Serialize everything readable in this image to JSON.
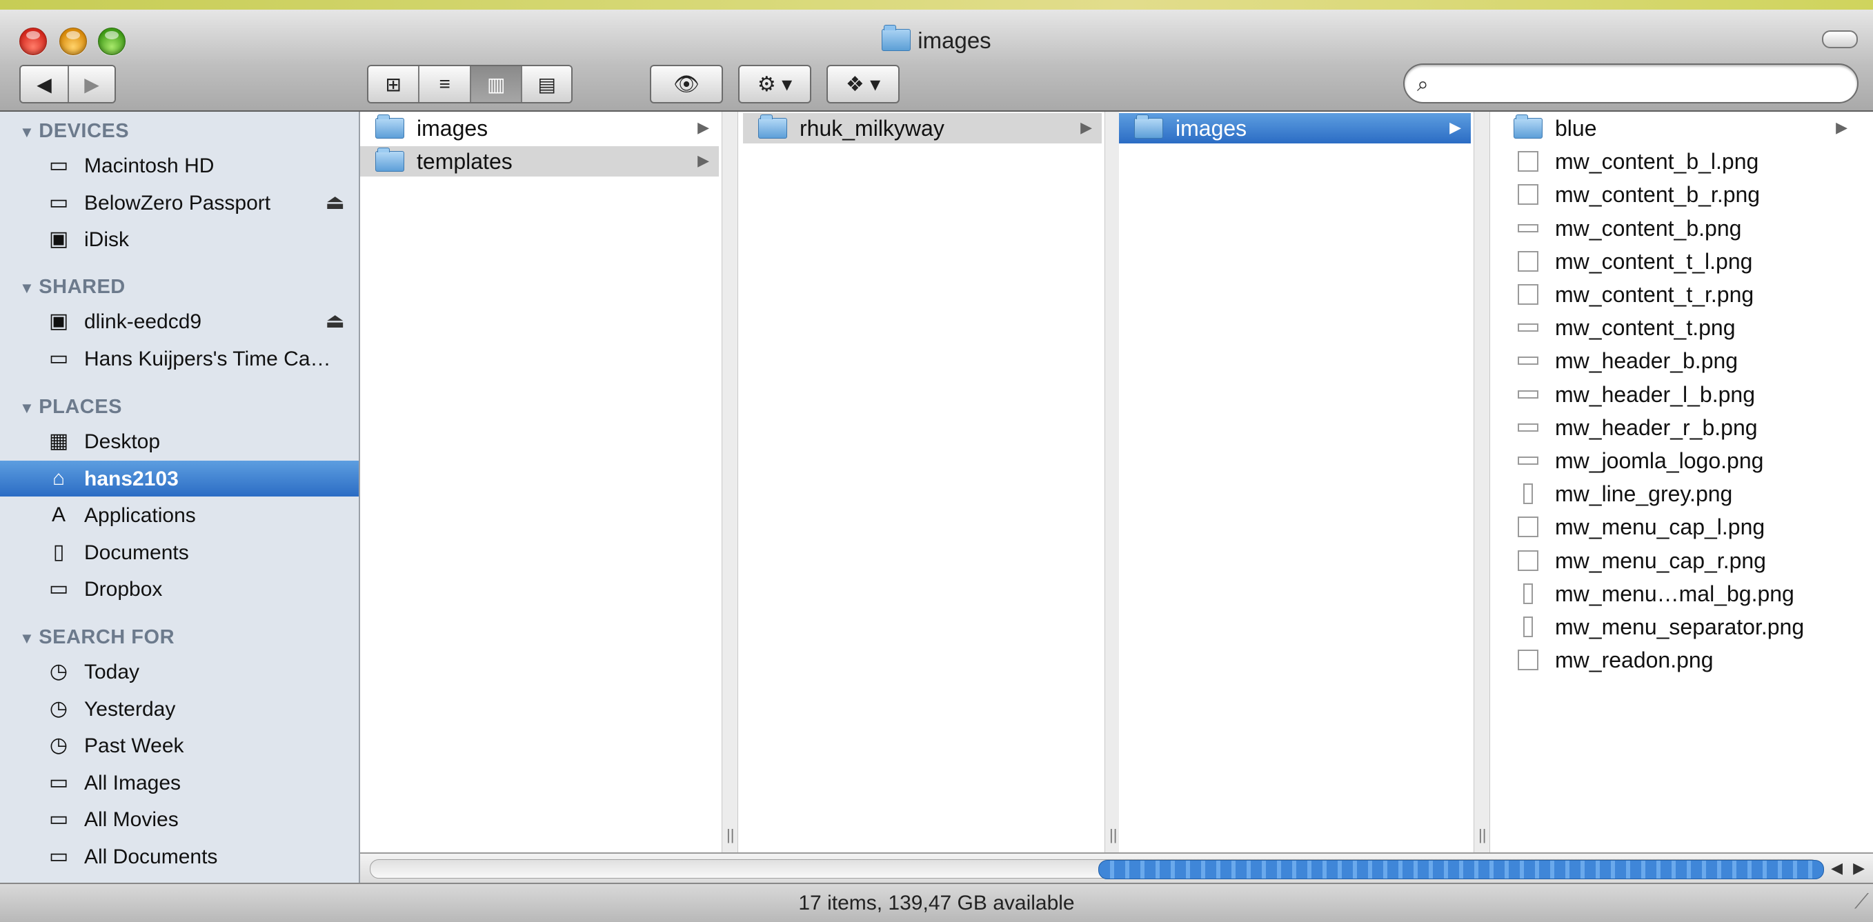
{
  "window": {
    "title": "images"
  },
  "toolbar": {
    "back_label": "◀",
    "forward_label": "▶",
    "view_icons": "⊞",
    "view_list": "≡",
    "view_columns": "▥",
    "view_coverflow": "▤",
    "quicklook_label": "👁",
    "action_label": "⚙ ▾",
    "dropbox_label": "❖ ▾",
    "search_placeholder": ""
  },
  "sidebar": {
    "sections": [
      {
        "label": "DEVICES",
        "items": [
          {
            "label": "Macintosh HD",
            "icon": "hard-disk-icon",
            "glyph": "▭",
            "eject": false
          },
          {
            "label": "BelowZero Passport",
            "icon": "external-disk-icon",
            "glyph": "▭",
            "eject": true
          },
          {
            "label": "iDisk",
            "icon": "idisk-icon",
            "glyph": "▣",
            "eject": false
          }
        ]
      },
      {
        "label": "SHARED",
        "items": [
          {
            "label": "dlink-eedcd9",
            "icon": "network-computer-icon",
            "glyph": "▣",
            "eject": true
          },
          {
            "label": "Hans Kuijpers's Time Ca…",
            "icon": "time-capsule-icon",
            "glyph": "▭",
            "eject": false
          }
        ]
      },
      {
        "label": "PLACES",
        "items": [
          {
            "label": "Desktop",
            "icon": "desktop-icon",
            "glyph": "▦"
          },
          {
            "label": "hans2103",
            "icon": "home-icon",
            "glyph": "⌂",
            "selected": true
          },
          {
            "label": "Applications",
            "icon": "applications-icon",
            "glyph": "A"
          },
          {
            "label": "Documents",
            "icon": "documents-icon",
            "glyph": "▯"
          },
          {
            "label": "Dropbox",
            "icon": "dropbox-folder-icon",
            "glyph": "▭"
          }
        ]
      },
      {
        "label": "SEARCH FOR",
        "items": [
          {
            "label": "Today",
            "icon": "clock-icon",
            "glyph": "◷"
          },
          {
            "label": "Yesterday",
            "icon": "clock-icon",
            "glyph": "◷"
          },
          {
            "label": "Past Week",
            "icon": "clock-icon",
            "glyph": "◷"
          },
          {
            "label": "All Images",
            "icon": "smart-folder-icon",
            "glyph": "▭"
          },
          {
            "label": "All Movies",
            "icon": "smart-folder-icon",
            "glyph": "▭"
          },
          {
            "label": "All Documents",
            "icon": "smart-folder-icon",
            "glyph": "▭"
          }
        ]
      }
    ]
  },
  "columns": [
    {
      "items": [
        {
          "name": "images",
          "type": "folder",
          "state": "none",
          "has_children": true
        },
        {
          "name": "templates",
          "type": "folder",
          "state": "path",
          "has_children": true
        }
      ]
    },
    {
      "items": [
        {
          "name": "rhuk_milkyway",
          "type": "folder",
          "state": "path",
          "has_children": true
        }
      ]
    },
    {
      "items": [
        {
          "name": "images",
          "type": "folder",
          "state": "selected",
          "has_children": true
        }
      ]
    },
    {
      "items": [
        {
          "name": "blue",
          "type": "folder",
          "state": "none",
          "has_children": true
        },
        {
          "name": "mw_content_b_l.png",
          "type": "file",
          "shape": "square"
        },
        {
          "name": "mw_content_b_r.png",
          "type": "file",
          "shape": "square"
        },
        {
          "name": "mw_content_b.png",
          "type": "file",
          "shape": "flat"
        },
        {
          "name": "mw_content_t_l.png",
          "type": "file",
          "shape": "square"
        },
        {
          "name": "mw_content_t_r.png",
          "type": "file",
          "shape": "square"
        },
        {
          "name": "mw_content_t.png",
          "type": "file",
          "shape": "flat"
        },
        {
          "name": "mw_header_b.png",
          "type": "file",
          "shape": "flat"
        },
        {
          "name": "mw_header_l_b.png",
          "type": "file",
          "shape": "flat"
        },
        {
          "name": "mw_header_r_b.png",
          "type": "file",
          "shape": "flat"
        },
        {
          "name": "mw_joomla_logo.png",
          "type": "file",
          "shape": "flat"
        },
        {
          "name": "mw_line_grey.png",
          "type": "file",
          "shape": "thin"
        },
        {
          "name": "mw_menu_cap_l.png",
          "type": "file",
          "shape": "square"
        },
        {
          "name": "mw_menu_cap_r.png",
          "type": "file",
          "shape": "square"
        },
        {
          "name": "mw_menu…mal_bg.png",
          "type": "file",
          "shape": "thin"
        },
        {
          "name": "mw_menu_separator.png",
          "type": "file",
          "shape": "thin"
        },
        {
          "name": "mw_readon.png",
          "type": "file",
          "shape": "square"
        }
      ]
    }
  ],
  "status": {
    "text": "17 items, 139,47 GB available"
  },
  "colors": {
    "selection": "#2b6cc4",
    "sidebar_bg": "#dfe5ed",
    "section_header": "#6c7a8c"
  }
}
